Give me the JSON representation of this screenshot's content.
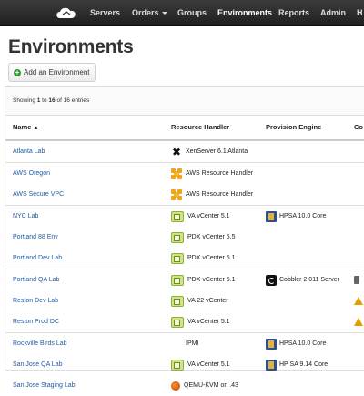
{
  "nav": {
    "items": [
      {
        "label": "Servers",
        "active": false,
        "caret": false
      },
      {
        "label": "Orders",
        "active": false,
        "caret": true
      },
      {
        "label": "Groups",
        "active": false,
        "caret": false
      },
      {
        "label": "Environments",
        "active": true,
        "caret": false
      },
      {
        "label": "Reports",
        "active": false,
        "caret": false
      },
      {
        "label": "Admin",
        "active": false,
        "caret": false
      },
      {
        "label": "H",
        "active": false,
        "caret": false
      }
    ]
  },
  "page": {
    "title": "Environments",
    "add_button": "Add an Environment"
  },
  "table": {
    "showing": {
      "prefix": "Showing ",
      "from": "1",
      "middle": " to ",
      "to": "16",
      "suffix": " of 16 entries"
    },
    "columns": {
      "name": "Name",
      "resource_handler": "Resource Handler",
      "provision_engine": "Provision Engine",
      "cut": "Co"
    },
    "rows": [
      {
        "name": "Atlanta Lab",
        "rh": "XenServer 6.1 Atlanta",
        "rh_icon": "xen-icon",
        "pe": "",
        "pe_icon": "",
        "extra_icon": "",
        "sep": false
      },
      {
        "name": "AWS Oregon",
        "rh": "AWS Resource Handler",
        "rh_icon": "aws-icon",
        "pe": "",
        "pe_icon": "",
        "extra_icon": "",
        "sep": true
      },
      {
        "name": "AWS Secure VPC",
        "rh": "AWS Resource Handler",
        "rh_icon": "aws-icon",
        "pe": "",
        "pe_icon": "",
        "extra_icon": "",
        "sep": false
      },
      {
        "name": "NYC Lab",
        "rh": "VA vCenter 5.1",
        "rh_icon": "vcenter-icon",
        "pe": "HPSA 10.0 Core",
        "pe_icon": "hpsa-icon",
        "extra_icon": "",
        "sep": true
      },
      {
        "name": "Portland 88 Env",
        "rh": "PDX vCenter 5.5",
        "rh_icon": "vcenter-icon",
        "pe": "",
        "pe_icon": "",
        "extra_icon": "",
        "sep": false
      },
      {
        "name": "Portland Dev Lab",
        "rh": "PDX vCenter 5.1",
        "rh_icon": "vcenter-icon",
        "pe": "",
        "pe_icon": "",
        "extra_icon": "",
        "sep": false
      },
      {
        "name": "Portland QA Lab",
        "rh": "PDX vCenter 5.1",
        "rh_icon": "vcenter-icon",
        "pe": "Cobbler 2.011 Server",
        "pe_icon": "cobbler-icon",
        "extra_icon": "small-icon",
        "sep": true
      },
      {
        "name": "Reston Dev Lab",
        "rh": "VA 22 vCenter",
        "rh_icon": "vcenter-icon",
        "pe": "",
        "pe_icon": "",
        "extra_icon": "warning-icon",
        "sep": false
      },
      {
        "name": "Reston Prod DC",
        "rh": "VA vCenter 5.1",
        "rh_icon": "vcenter-icon",
        "pe": "",
        "pe_icon": "",
        "extra_icon": "warning-icon",
        "sep": false
      },
      {
        "name": "Rockville Birds Lab",
        "rh": "IPMI",
        "rh_icon": "",
        "pe": "HPSA 10.0 Core",
        "pe_icon": "hpsa-icon",
        "extra_icon": "",
        "sep": true
      },
      {
        "name": "San Jose QA Lab",
        "rh": "VA vCenter 5.1",
        "rh_icon": "vcenter-icon",
        "pe": "HP SA 9.14 Core",
        "pe_icon": "hpsa-icon",
        "extra_icon": "",
        "sep": false
      },
      {
        "name": "San Jose Staging Lab",
        "rh": "QEMU-KVM on .43",
        "rh_icon": "qemu-icon",
        "pe": "",
        "pe_icon": "",
        "extra_icon": "",
        "sep": false
      }
    ]
  }
}
